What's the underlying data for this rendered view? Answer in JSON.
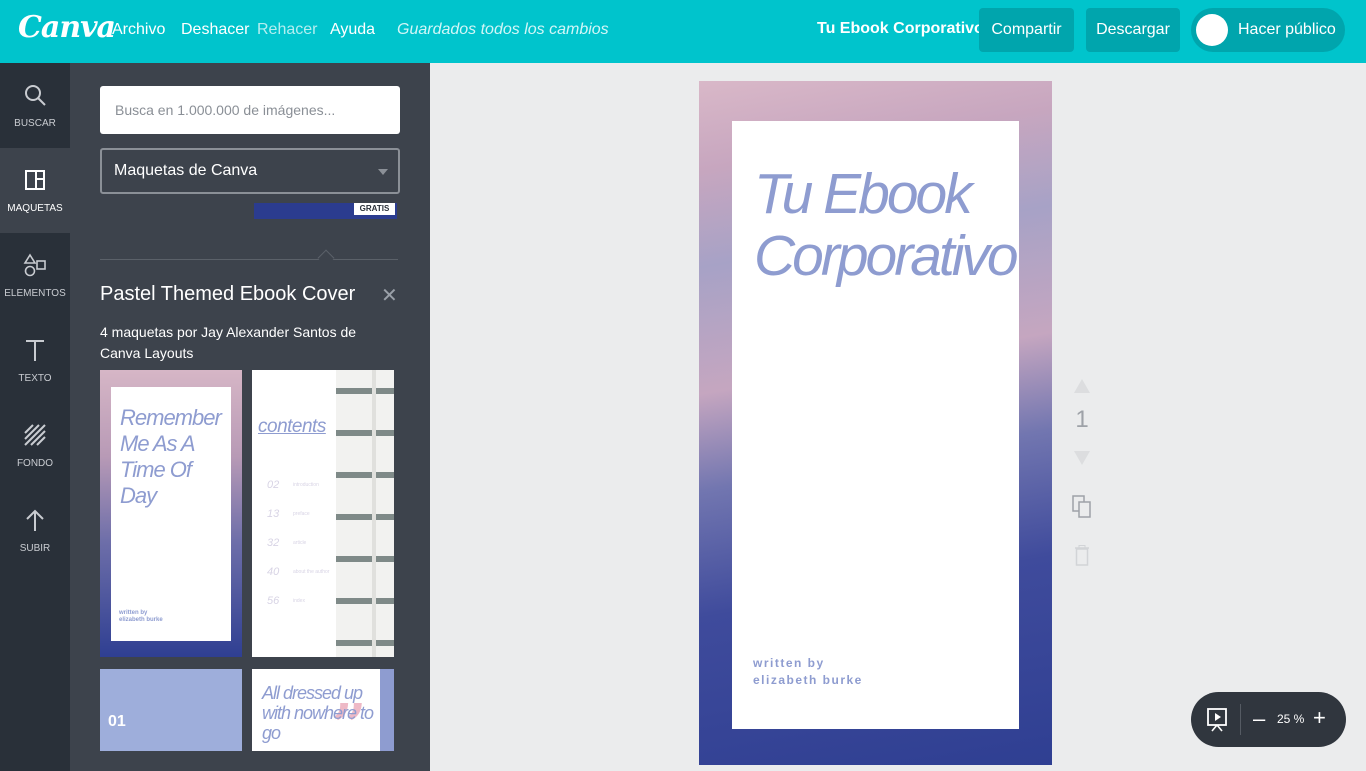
{
  "topbar": {
    "logo": "Canva",
    "menu": [
      "Archivo",
      "Deshacer",
      "Rehacer",
      "Ayuda"
    ],
    "saved_status": "Guardados todos los cambios",
    "document_title": "Tu Ebook Corporativo",
    "share_label": "Compartir",
    "download_label": "Descargar",
    "public_toggle_label": "Hacer público",
    "public_toggle_on": false
  },
  "rail": {
    "items": [
      {
        "label": "Buscar",
        "icon": "search-icon"
      },
      {
        "label": "Maquetas",
        "icon": "layout-icon",
        "active": true
      },
      {
        "label": "Elementos",
        "icon": "shapes-icon"
      },
      {
        "label": "Texto",
        "icon": "text-icon"
      },
      {
        "label": "Fondo",
        "icon": "background-icon"
      },
      {
        "label": "Subir",
        "icon": "upload-icon"
      }
    ]
  },
  "panel": {
    "search_placeholder": "Busca en 1.000.000 de imágenes...",
    "category_selected": "Maquetas de Canva",
    "previous_badge": "GRATIS",
    "section_title": "Pastel Themed Ebook Cover",
    "section_subtitle": "4 maquetas por Jay Alexander Santos de Canva Layouts",
    "thumbnails": {
      "t1_title": "Remember Me As A Time Of Day",
      "t1_byline": "written by elizabeth burke",
      "t2_title": "contents",
      "t2_rows": [
        {
          "num": "02",
          "label": "introduction"
        },
        {
          "num": "13",
          "label": "preface"
        },
        {
          "num": "32",
          "label": "article"
        },
        {
          "num": "40",
          "label": "about the author"
        },
        {
          "num": "56",
          "label": "index"
        }
      ],
      "t3_number": "01",
      "t4_text": "All dressed up with nowhere to go",
      "t4_quote": "”"
    }
  },
  "canvas": {
    "title": "Tu Ebook Corporativo",
    "byline_1": "written by",
    "byline_2": "elizabeth burke",
    "page_number": "1"
  },
  "zoom": {
    "minus": "–",
    "value": "25 %",
    "plus": "+"
  },
  "colors": {
    "topbar": "#00c4cc",
    "accent_text": "#8e9cd0",
    "rail": "#293039",
    "panel": "#3d434c"
  }
}
